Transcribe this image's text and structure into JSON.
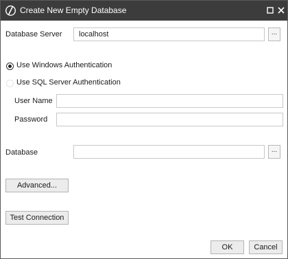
{
  "window": {
    "title": "Create New Empty Database"
  },
  "server": {
    "label": "Database Server",
    "value": "localhost",
    "browse_label": "..."
  },
  "auth": {
    "windows_label": "Use Windows Authentication",
    "windows_selected": true,
    "sql_label": "Use SQL Server Authentication",
    "sql_selected": false,
    "username_label": "User Name",
    "username_value": "",
    "password_label": "Password",
    "password_value": ""
  },
  "database": {
    "label": "Database",
    "value": "",
    "browse_label": "..."
  },
  "buttons": {
    "advanced": "Advanced...",
    "test_connection": "Test Connection",
    "ok": "OK",
    "cancel": "Cancel"
  },
  "colors": {
    "titlebar": "#3c3c3c",
    "border": "#c8c8c8",
    "button_bg": "#ececec"
  }
}
